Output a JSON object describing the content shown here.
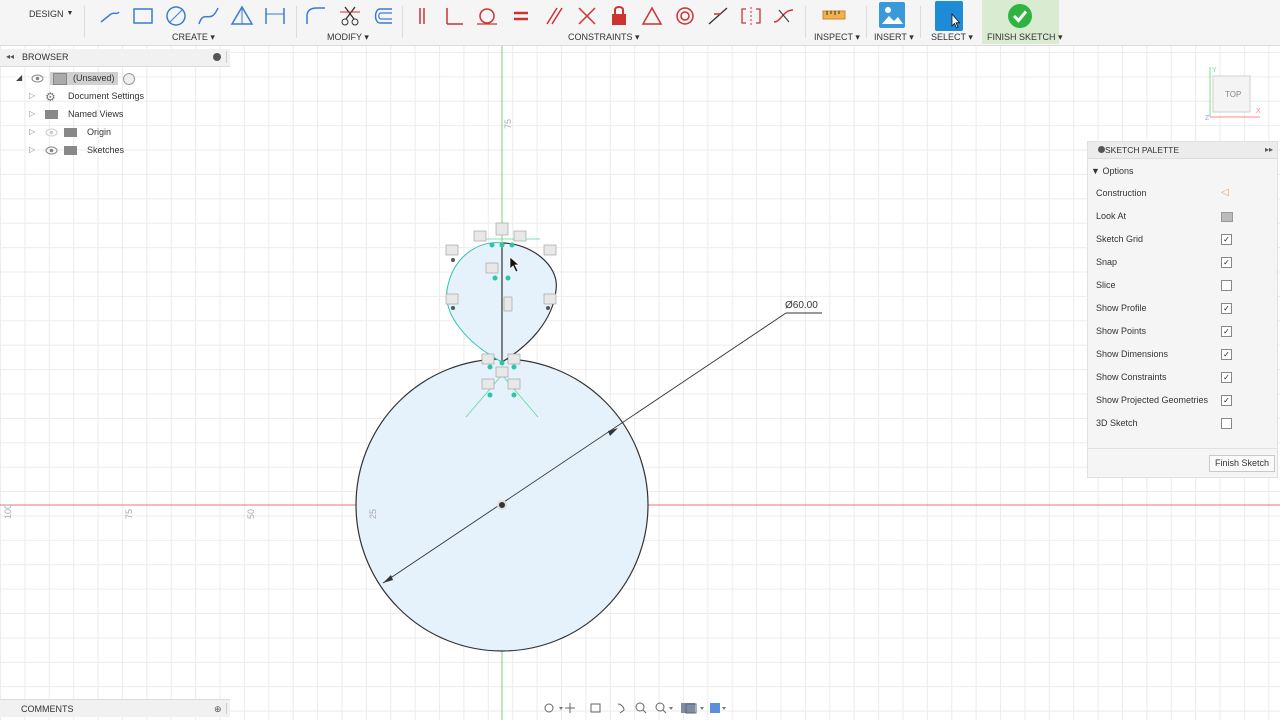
{
  "toolbar": {
    "design_label": "DESIGN",
    "groups": {
      "create": "CREATE",
      "modify": "MODIFY",
      "constraints": "CONSTRAINTS",
      "inspect": "INSPECT",
      "insert": "INSERT",
      "select": "SELECT",
      "finish_sketch": "FINISH SKETCH"
    }
  },
  "browser": {
    "title": "BROWSER",
    "items": [
      {
        "label": "(Unsaved)"
      },
      {
        "label": "Document Settings"
      },
      {
        "label": "Named Views"
      },
      {
        "label": "Origin"
      },
      {
        "label": "Sketches"
      }
    ]
  },
  "comments": {
    "title": "COMMENTS"
  },
  "canvas": {
    "axis_labels": {
      "v75": "75",
      "h100": "100",
      "h75": "75",
      "h50": "50",
      "h25": "25"
    },
    "dimension": "Ø60.00",
    "viewcube_label": "TOP",
    "colors": {
      "profile_fill": "#e6f2fb",
      "constraint": "#2ec4a6",
      "axis_red": "#ee4444",
      "axis_green": "#55cc55"
    }
  },
  "sketch_palette": {
    "title": "SKETCH PALETTE",
    "options_label": "Options",
    "rows": [
      {
        "label": "Construction",
        "state": "icon"
      },
      {
        "label": "Look At",
        "state": "icon"
      },
      {
        "label": "Sketch Grid",
        "state": "checked"
      },
      {
        "label": "Snap",
        "state": "checked"
      },
      {
        "label": "Slice",
        "state": "unchecked"
      },
      {
        "label": "Show Profile",
        "state": "checked"
      },
      {
        "label": "Show Points",
        "state": "checked"
      },
      {
        "label": "Show Dimensions",
        "state": "checked"
      },
      {
        "label": "Show Constraints",
        "state": "checked"
      },
      {
        "label": "Show Projected Geometries",
        "state": "checked"
      },
      {
        "label": "3D Sketch",
        "state": "unchecked"
      }
    ],
    "finish_button": "Finish Sketch"
  }
}
